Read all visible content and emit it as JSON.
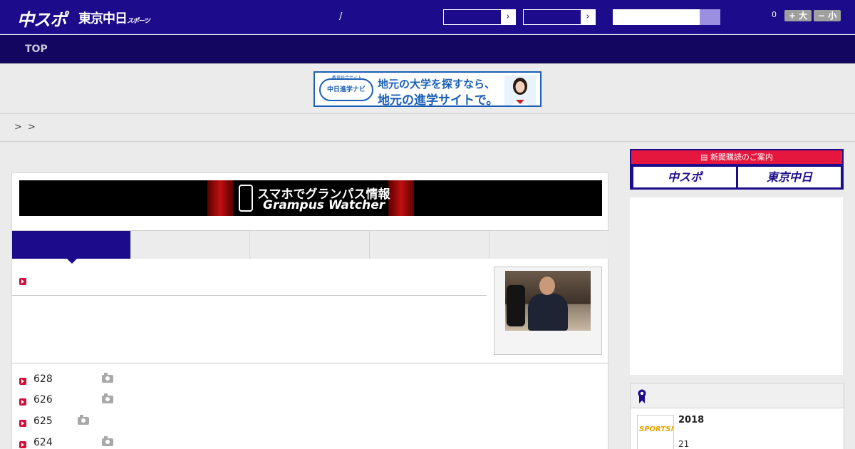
{
  "header": {
    "logo_chuspo": "中スポ",
    "logo_tokyo": "東京中日",
    "logo_tokyo_small": "スポーツ",
    "slash": "/",
    "select_arrow": "›",
    "counter": "0",
    "font_larger": "+ 大",
    "font_smaller": "− 小"
  },
  "nav": {
    "top": "TOP"
  },
  "banner": {
    "tagline": "教育総合サイト",
    "logo_text": "中日進学ナビ",
    "line1": "地元の大学を探すなら、",
    "line2": "地元の進学サイトで。"
  },
  "breadcrumb": {
    "sep1": ">",
    "sep2": ">"
  },
  "grampus_banner": {
    "line1": "スマホでグランパス情報",
    "line2": "Grampus Watcher"
  },
  "news": [
    {
      "date": "628",
      "has_photo": true
    },
    {
      "date": "626",
      "has_photo": true
    },
    {
      "date": "625",
      "has_photo": true
    },
    {
      "date": "624",
      "has_photo": true
    }
  ],
  "subscribe": {
    "head": "新聞購読のご案内",
    "chuspo": "中スポ",
    "tokyo": "東京中日"
  },
  "ranking": {
    "thumb_text": "SPORTS!!",
    "title": "2018",
    "sub": "21"
  },
  "colors": {
    "brand": "#1c0b8a",
    "nav": "#130660",
    "accent_red": "#e6173e",
    "marker": "#d0103a"
  }
}
